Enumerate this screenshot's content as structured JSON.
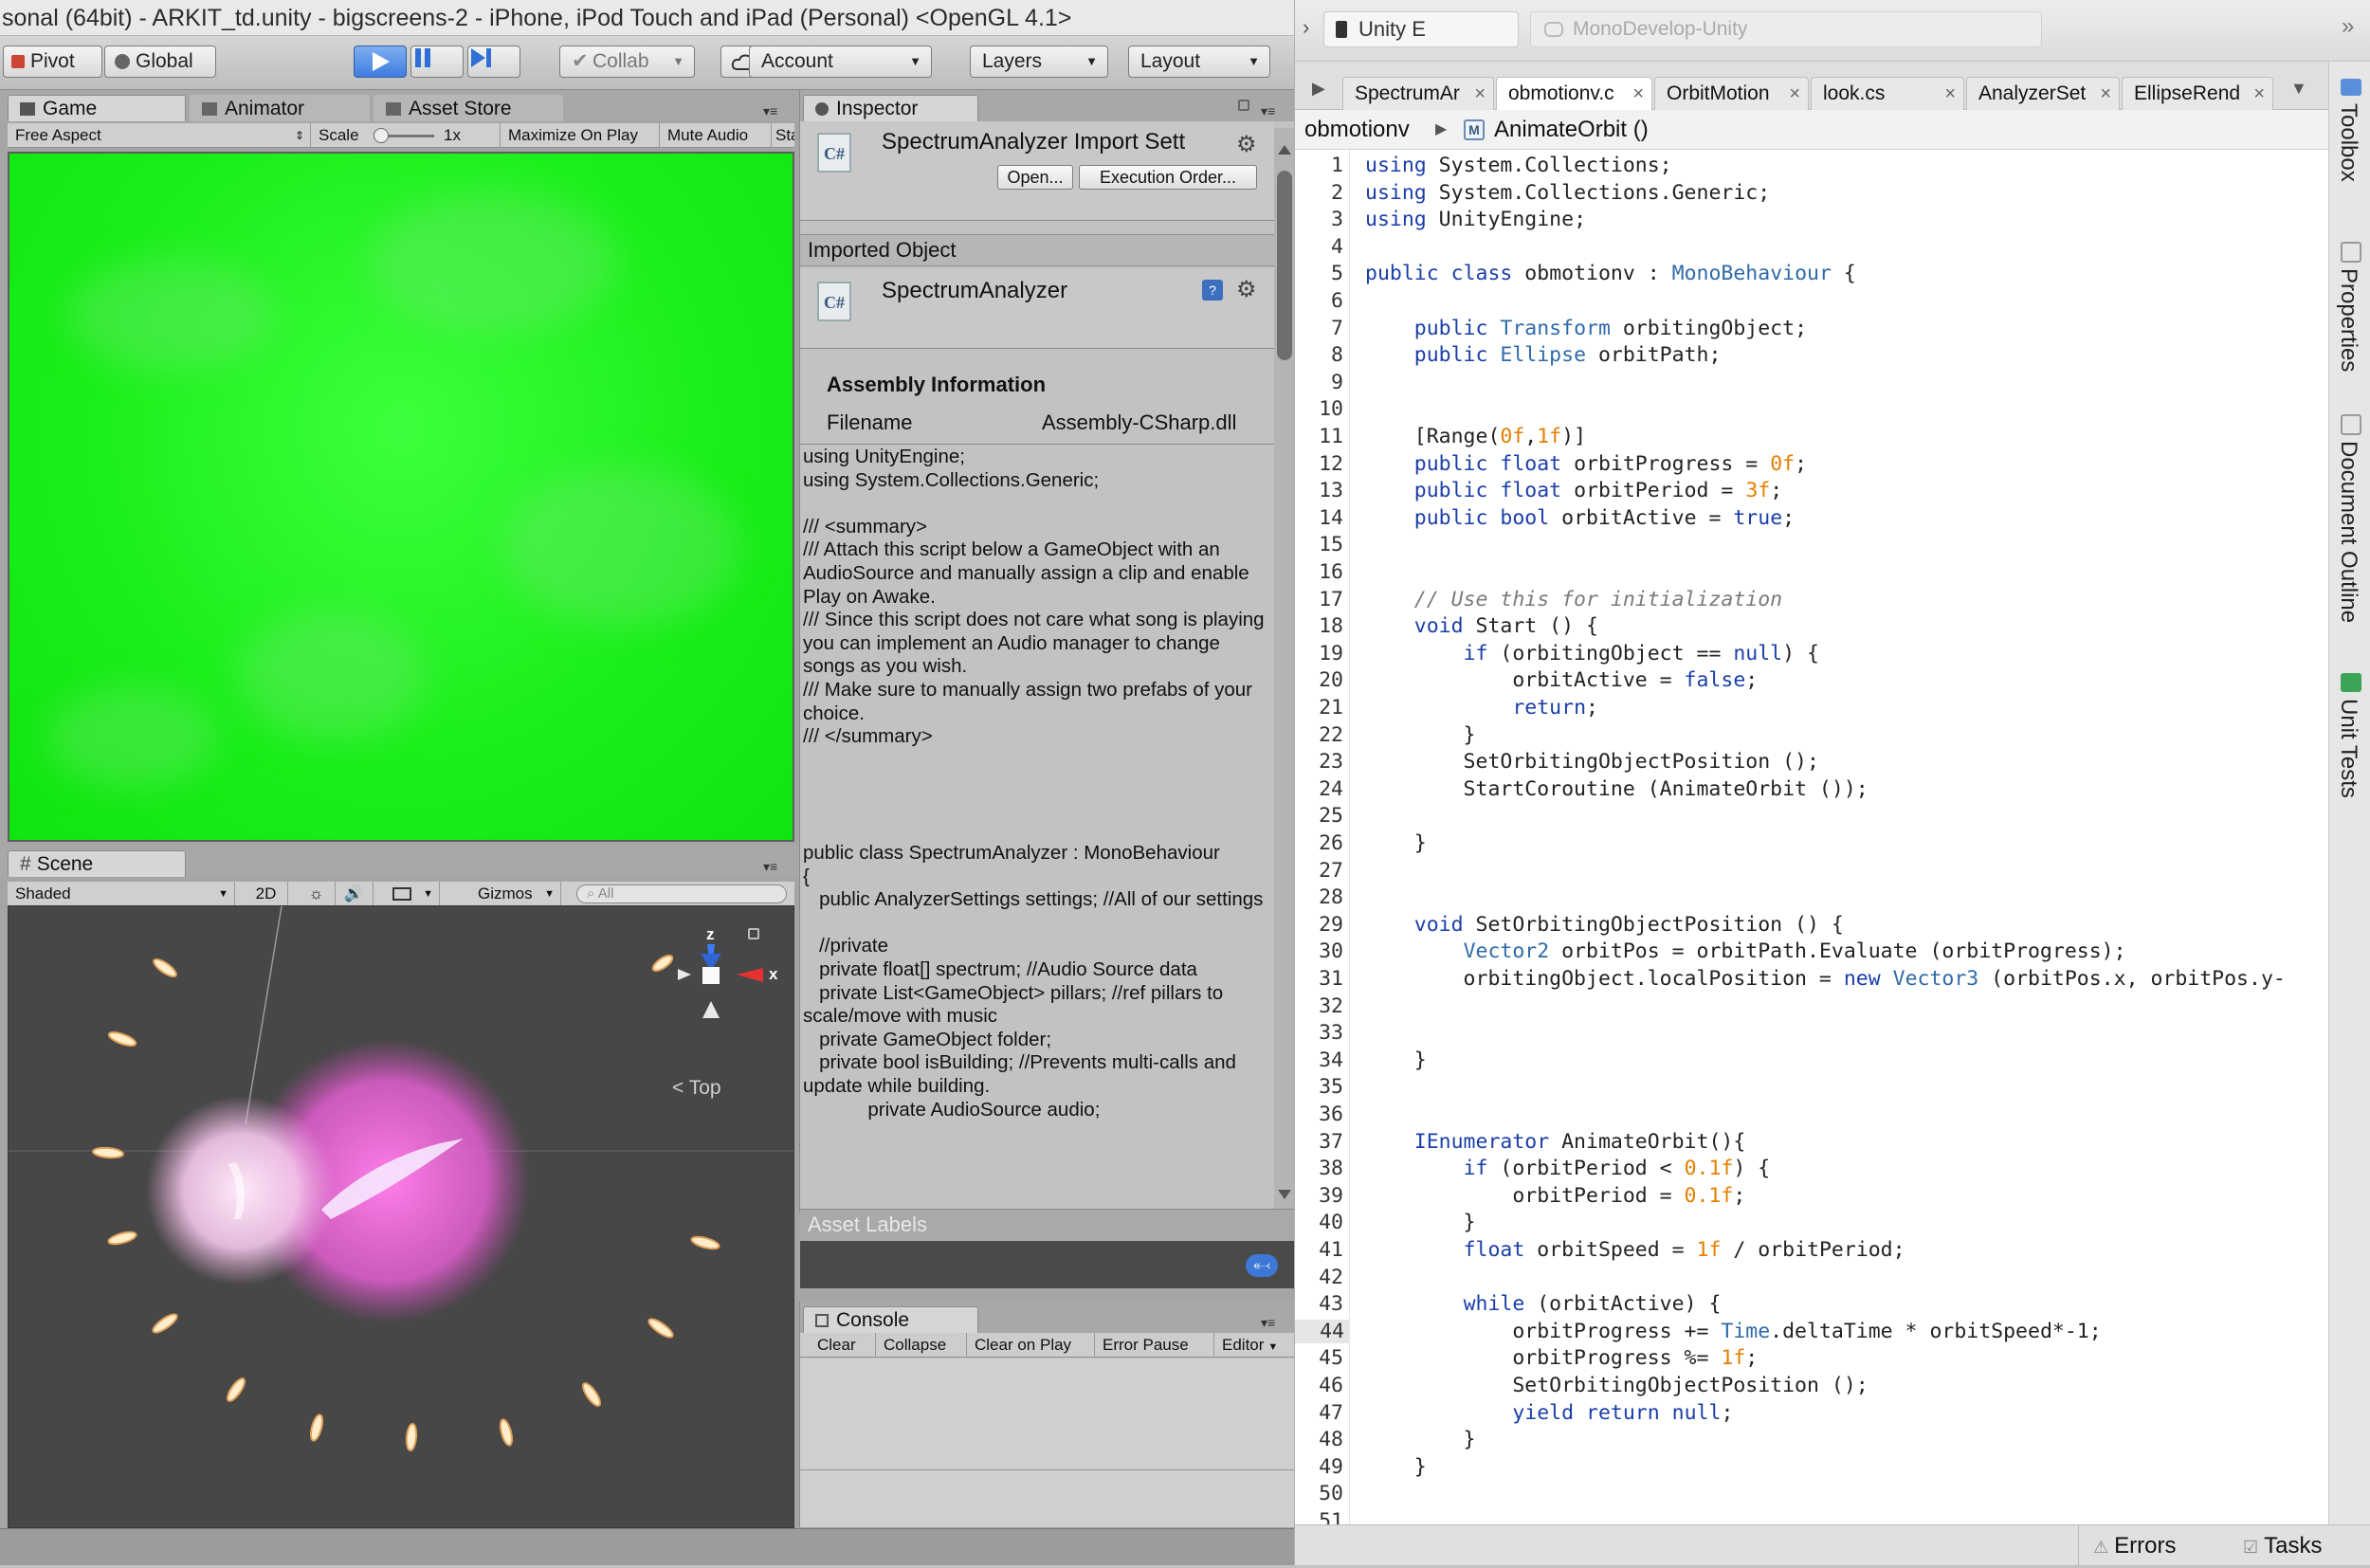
{
  "unity": {
    "window_title": "sonal (64bit) - ARKIT_td.unity - bigscreens-2 - iPhone, iPod Touch and iPad (Personal) <OpenGL 4.1>",
    "toolbar": {
      "pivot": "Pivot",
      "global": "Global",
      "collab": "Collab",
      "account": "Account",
      "layers": "Layers",
      "layout": "Layout"
    },
    "game_tabs": [
      "Game",
      "Animator",
      "Asset Store"
    ],
    "game_bar": {
      "aspect": "Free Aspect",
      "scale_label": "Scale",
      "scale_value": "1x",
      "maximize": "Maximize On Play",
      "mute": "Mute Audio",
      "stats": "Sta"
    },
    "scene": {
      "tab": "Scene",
      "shading": "Shaded",
      "mode_2d": "2D",
      "gizmos": "Gizmos",
      "search_placeholder": "All",
      "axis_z": "z",
      "axis_x": "x",
      "top_label": "Top"
    },
    "inspector": {
      "tab": "Inspector",
      "title": "SpectrumAnalyzer Import Sett",
      "open_btn": "Open...",
      "exec_btn": "Execution Order...",
      "imported_object": "Imported Object",
      "object_name": "SpectrumAnalyzer",
      "assembly_info": "Assembly Information",
      "filename_label": "Filename",
      "filename_value": "Assembly-CSharp.dll",
      "code": "using UnityEngine;\nusing System.Collections.Generic;\n\n/// <summary>\n/// Attach this script below a GameObject with an AudioSource and manually assign a clip and enable Play on Awake.\n/// Since this script does not care what song is playing you can implement an Audio manager to change songs as you wish.\n/// Make sure to manually assign two prefabs of your choice.\n/// </summary>\n\n\n\n\npublic class SpectrumAnalyzer : MonoBehaviour\n{\n   public AnalyzerSettings settings; //All of our settings\n\n   //private\n   private float[] spectrum; //Audio Source data\n   private List<GameObject> pillars; //ref pillars to scale/move with music\n   private GameObject folder;\n   private bool isBuilding; //Prevents multi-calls and update while building.\n            private AudioSource audio;",
      "asset_labels": "Asset Labels"
    },
    "console": {
      "tab": "Console",
      "clear": "Clear",
      "collapse": "Collapse",
      "clear_on_play": "Clear on Play",
      "error_pause": "Error Pause",
      "editor": "Editor"
    }
  },
  "mono": {
    "unity_target": "Unity E",
    "app_name": "MonoDevelop-Unity",
    "tabs": [
      "SpectrumAr",
      "obmotionv.c",
      "OrbitMotion",
      "look.cs",
      "AnalyzerSet",
      "EllipseRend"
    ],
    "breadcrumb": {
      "class": "obmotionv",
      "method": "AnimateOrbit ()"
    },
    "dock": [
      "Toolbox",
      "Properties",
      "Document Outline",
      "Unit Tests"
    ],
    "status": {
      "errors": "Errors",
      "tasks": "Tasks"
    },
    "code_lines": [
      "using System.Collections;",
      "using System.Collections.Generic;",
      "using UnityEngine;",
      "",
      "public class obmotionv : MonoBehaviour {",
      "",
      "    public Transform orbitingObject;",
      "    public Ellipse orbitPath;",
      "",
      "",
      "    [Range(0f,1f)]",
      "    public float orbitProgress = 0f;",
      "    public float orbitPeriod = 3f;",
      "    public bool orbitActive = true;",
      "",
      "",
      "    // Use this for initialization",
      "    void Start () {",
      "        if (orbitingObject == null) {",
      "            orbitActive = false;",
      "            return;",
      "        }",
      "        SetOrbitingObjectPosition ();",
      "        StartCoroutine (AnimateOrbit ());",
      "",
      "    }",
      "",
      "",
      "    void SetOrbitingObjectPosition () {",
      "        Vector2 orbitPos = orbitPath.Evaluate (orbitProgress);",
      "        orbitingObject.localPosition = new Vector3 (orbitPos.x, orbitPos.y-",
      "",
      "",
      "    }",
      "",
      "",
      "    IEnumerator AnimateOrbit(){",
      "        if (orbitPeriod < 0.1f) {",
      "            orbitPeriod = 0.1f;",
      "        }",
      "        float orbitSpeed = 1f / orbitPeriod;",
      "",
      "        while (orbitActive) {",
      "            orbitProgress += Time.deltaTime * orbitSpeed*-1;",
      "            orbitProgress %= 1f;",
      "            SetOrbitingObjectPosition ();",
      "            yield return null;",
      "        }",
      "    }",
      "",
      ""
    ]
  }
}
